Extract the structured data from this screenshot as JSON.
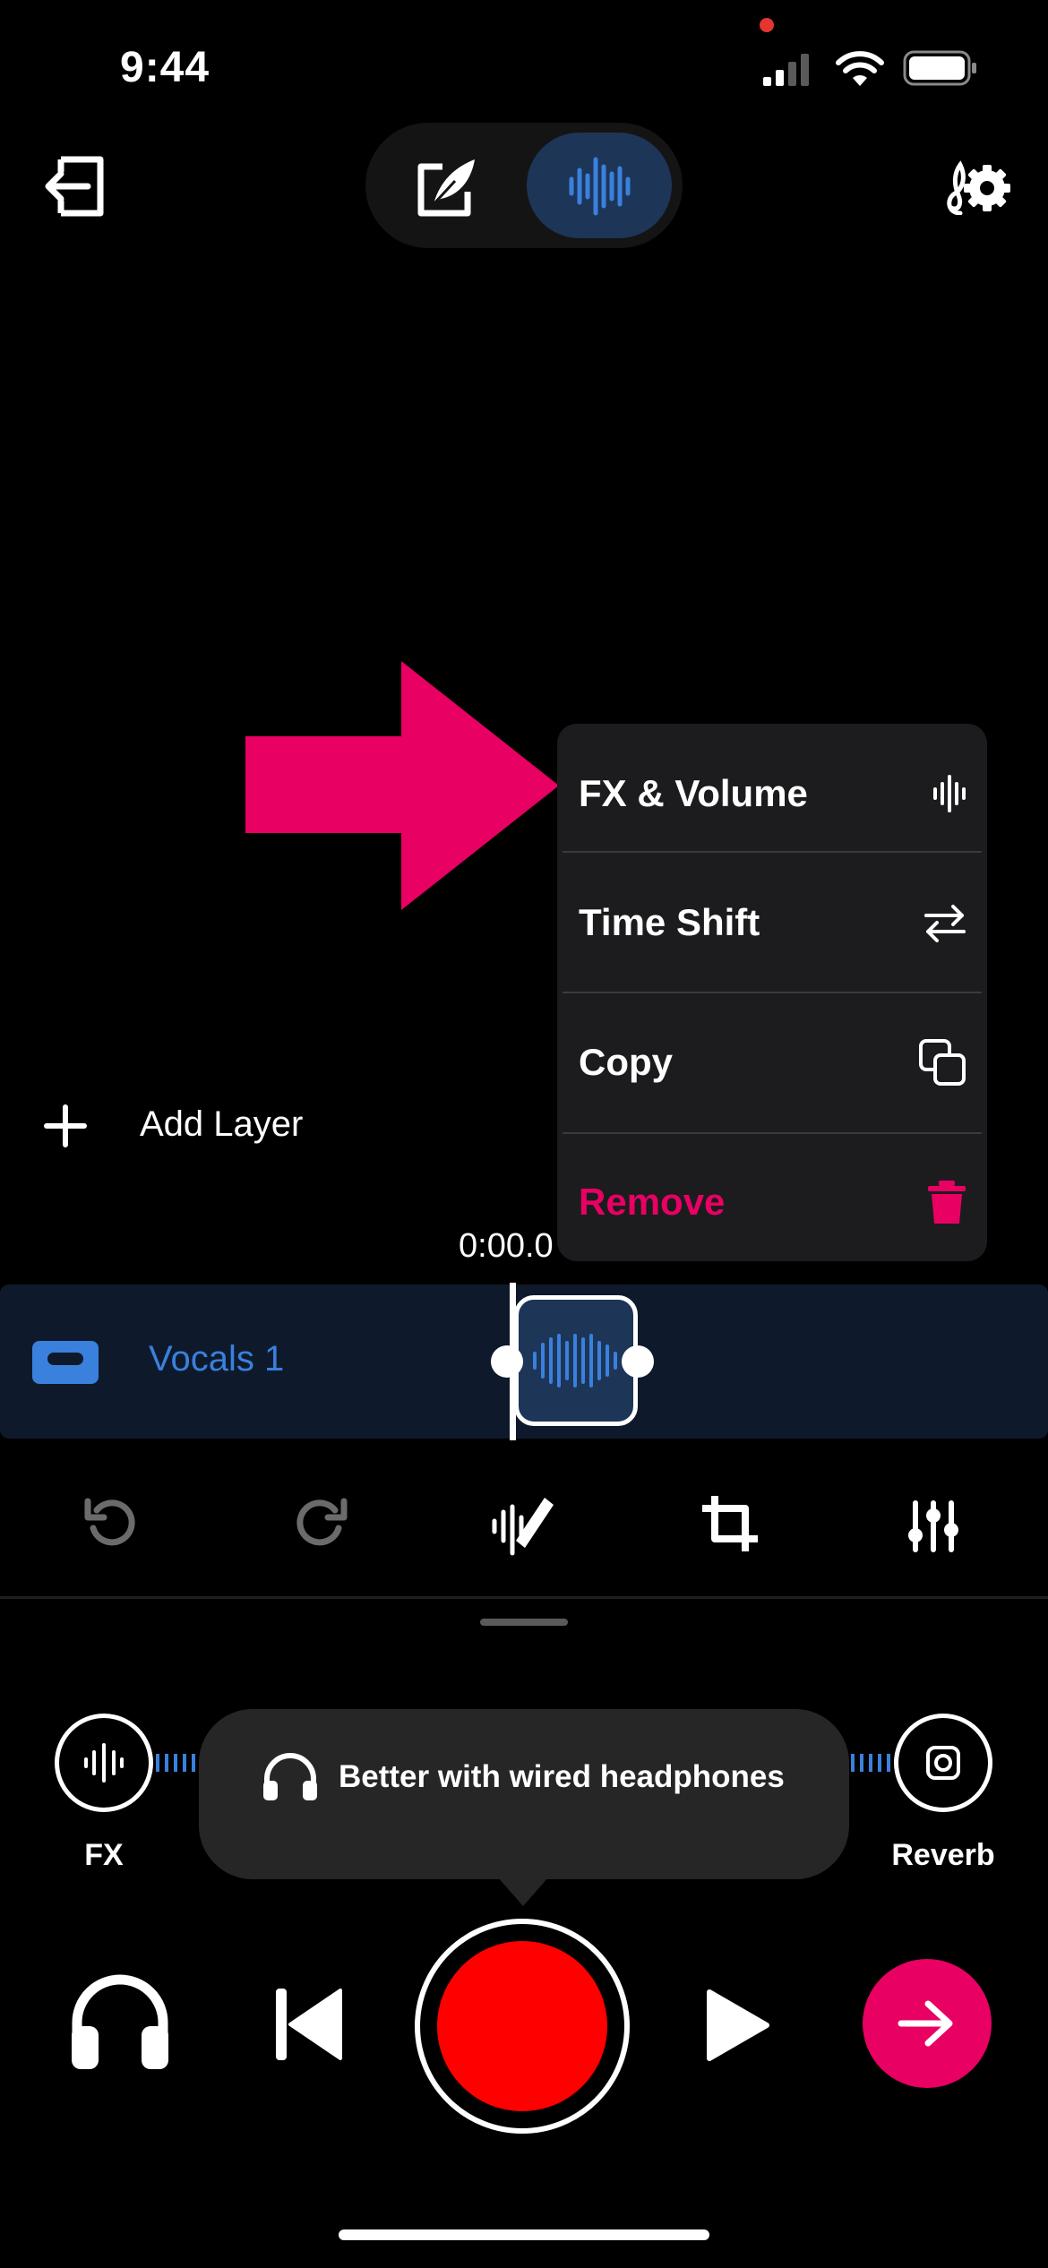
{
  "status_bar": {
    "time": "9:44"
  },
  "header": {
    "exit_icon": "exit-icon",
    "write_mode_icon": "quill-icon",
    "record_mode_icon": "waveform-icon",
    "settings_icon": "music-settings-icon"
  },
  "context_menu": {
    "items": [
      {
        "label": "FX & Volume",
        "icon": "waveform-icon"
      },
      {
        "label": "Time Shift",
        "icon": "swap-icon"
      },
      {
        "label": "Copy",
        "icon": "copy-icon"
      },
      {
        "label": "Remove",
        "icon": "trash-icon"
      }
    ]
  },
  "timeline": {
    "add_layer_label": "Add Layer",
    "time_readout": "0:00.0",
    "track_name": "Vocals 1"
  },
  "colors": {
    "accent_blue": "#3a80dd",
    "accent_pink": "#e80063",
    "record_red": "#ff0000",
    "track_bg": "#0e1a2b"
  },
  "fx_panel": {
    "fx_label": "FX",
    "reverb_label": "Reverb",
    "tooltip_text": "Better with wired headphones"
  }
}
